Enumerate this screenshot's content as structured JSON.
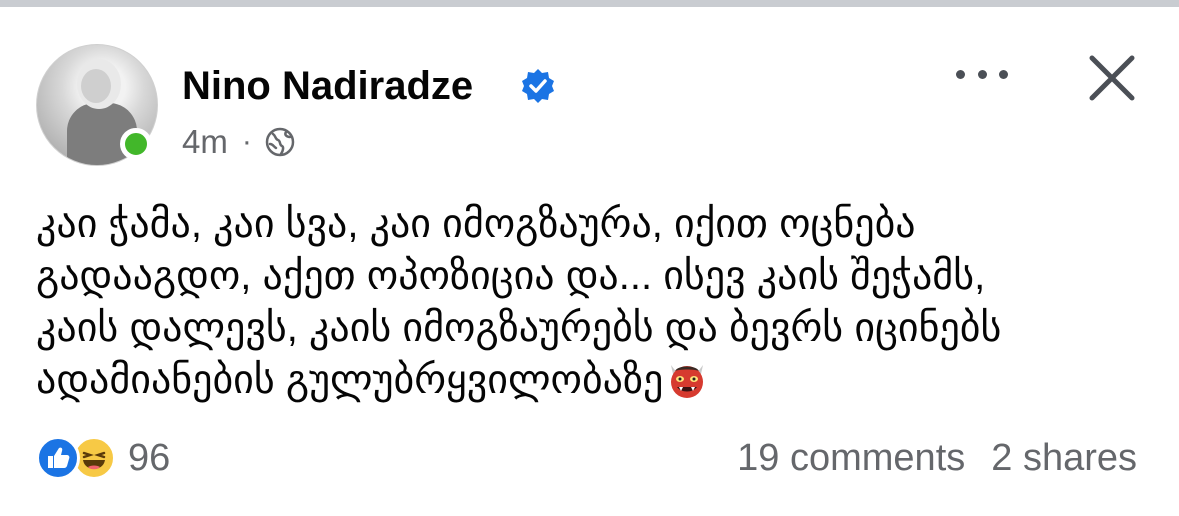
{
  "post": {
    "author": "Nino Nadiradze",
    "verified": true,
    "time": "4m",
    "separator": "·",
    "audience_icon": "globe-icon",
    "body_lines": [
      "კაი ჭამა, კაი სვა, კაი იმოგზაურა, იქით ოცნება",
      "გადააგდო, აქეთ ოპოზიცია და... ისევ კაის შეჭამს,",
      "კაის დალევს, კაის იმოგზაურებს და ბევრს იცინებს",
      "ადამიანების გულუბრყვილობაზე"
    ],
    "body_emoji": "ogre-emoji"
  },
  "reactions": {
    "types": [
      "like-icon",
      "haha-icon"
    ],
    "count": "96"
  },
  "stats": {
    "comments": "19 comments",
    "shares": "2 shares"
  },
  "colors": {
    "verified_blue": "#1b74e4",
    "online_green": "#42b72a",
    "secondary_text": "#65676b"
  }
}
